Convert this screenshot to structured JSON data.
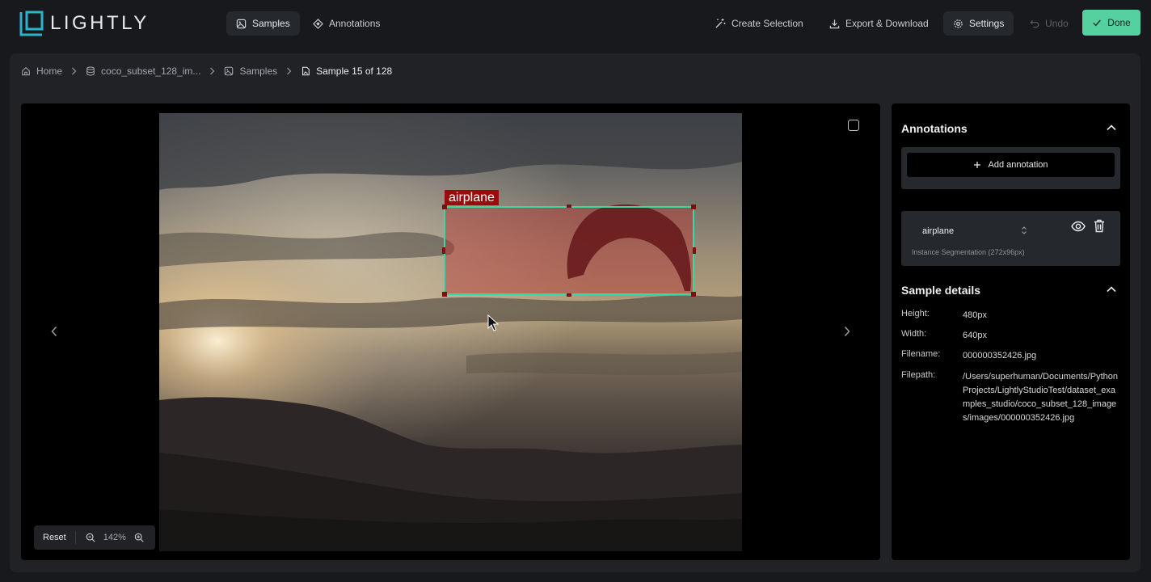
{
  "app": {
    "logo_text": "LIGHTLY"
  },
  "nav": {
    "samples": "Samples",
    "annotations": "Annotations",
    "create_selection": "Create Selection",
    "export": "Export & Download",
    "settings": "Settings",
    "undo": "Undo",
    "done": "Done"
  },
  "breadcrumb": {
    "home": "Home",
    "dataset": "coco_subset_128_im...",
    "samples": "Samples",
    "current": "Sample 15 of 128"
  },
  "viewer": {
    "box_label": "airplane",
    "zoom_reset": "Reset",
    "zoom_level": "142%"
  },
  "annotations": {
    "title": "Annotations",
    "add_label": "Add annotation",
    "items": [
      {
        "label": "airplane",
        "subtitle": "Instance Segmentation (272x96px)"
      }
    ]
  },
  "details": {
    "title": "Sample details",
    "rows": [
      {
        "key": "Height:",
        "value": "480px"
      },
      {
        "key": "Width:",
        "value": "640px"
      },
      {
        "key": "Filename:",
        "value": "000000352426.jpg"
      },
      {
        "key": "Filepath:",
        "value": "/Users/superhuman/Documents/PythonProjects/LightlyStudioTest/dataset_examples_studio/coco_subset_128_images/images/000000352426.jpg"
      }
    ]
  },
  "colors": {
    "accent": "#55d1a0",
    "bbox": "#3fd6a5",
    "label_bg": "#9c0b0b"
  }
}
